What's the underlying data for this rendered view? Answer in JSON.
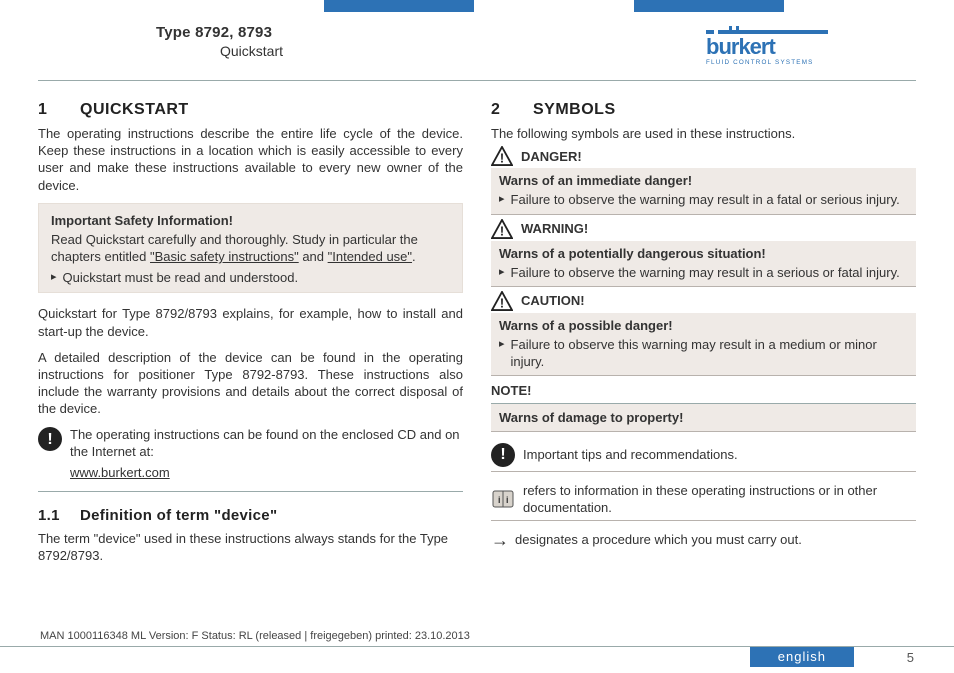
{
  "header": {
    "type_line": "Type 8792, 8793",
    "subtitle": "Quickstart",
    "brand": "burkert",
    "brand_tag": "FLUID CONTROL SYSTEMS"
  },
  "left": {
    "s1_num": "1",
    "s1_title": "QUICKSTART",
    "p1": "The operating instructions describe the entire life cycle of the device. Keep these instructions in a location which is easily accessible to every user and make these instructions available to every new owner of the device.",
    "safety_title": "Important Safety Information!",
    "safety_p": "Read Quickstart carefully and thoroughly. Study in particular the chapters entitled ",
    "safety_link1": "\"Basic safety instructions\"",
    "safety_and": " and ",
    "safety_link2": "\"Intended use\"",
    "safety_end": ".",
    "safety_bul": "Quickstart must be read and understood.",
    "p2": "Quickstart for Type 8792/8793 explains, for example, how to install and start-up the device.",
    "p3": "A detailed description of the device can be found in the operating instructions for positioner Type 8792-8793. These instructions also include the warranty provisions and details about the correct disposal of the device.",
    "info_p": "The operating instructions can be found on the enclosed CD and on the Internet at:",
    "info_link": "www.burkert.com",
    "s11_num": "1.1",
    "s11_title": "Definition of term \"device\"",
    "s11_p": "The term \"device\" used in these instructions always stands for the Type 8792/8793."
  },
  "right": {
    "s2_num": "2",
    "s2_title": "SYMBOLS",
    "intro": "The following symbols are used in these instructions.",
    "danger_lbl": "DANGER!",
    "danger_t": "Warns of an immediate danger!",
    "danger_b": "Failure to observe the warning may result in a fatal or serious injury.",
    "warning_lbl": "WARNING!",
    "warning_t": "Warns of a potentially dangerous situation!",
    "warning_b": "Failure to observe the warning may result in a serious or fatal injury.",
    "caution_lbl": "CAUTION!",
    "caution_t": "Warns of a possible danger!",
    "caution_b": "Failure to observe this warning may result in a medium or minor injury.",
    "note_lbl": "NOTE!",
    "note_t": "Warns of damage to property!",
    "tips": "Important tips and recommendations.",
    "ref": "refers to information in these operating instructions or in other documentation.",
    "arrow": "designates a procedure which you must carry out."
  },
  "footer": {
    "meta": "MAN  1000116348  ML   Version: F Status: RL (released | freigegeben)   printed: 23.10.2013",
    "lang": "english",
    "page": "5"
  }
}
